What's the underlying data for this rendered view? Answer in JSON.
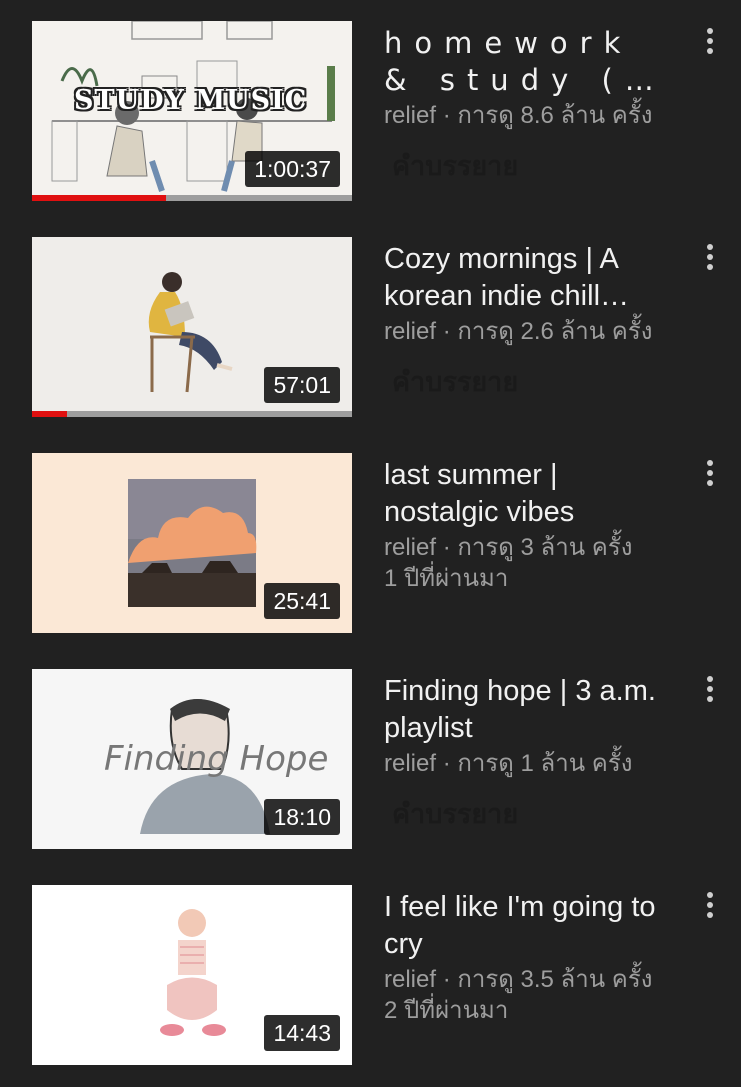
{
  "videos": [
    {
      "title_line1": "homework",
      "title_line2": "& study (…",
      "meta": "relief · การดู 8.6 ล้าน ครั้ง",
      "sub": "คำบรรยาย",
      "duration": "1:00:37",
      "progress": 0.42,
      "thumb_text": "STUDY MUSIC"
    },
    {
      "title": "Cozy mornings | A korean indie chill…",
      "meta": "relief · การดู 2.6 ล้าน ครั้ง",
      "sub": "คำบรรยาย",
      "duration": "57:01",
      "progress": 0.11
    },
    {
      "title": "last summer | nostalgic vibes",
      "meta": "relief · การดู 3 ล้าน ครั้ง",
      "sub": "1 ปีที่ผ่านมา",
      "duration": "25:41"
    },
    {
      "title": "Finding hope | 3 a.m. playlist",
      "meta": "relief · การดู 1 ล้าน ครั้ง",
      "sub": "คำบรรยาย",
      "duration": "18:10",
      "thumb_text": "Finding Hope"
    },
    {
      "title": "I feel like I'm going to cry",
      "meta": "relief · การดู 3.5 ล้าน ครั้ง",
      "sub": "2 ปีที่ผ่านมา",
      "duration": "14:43"
    }
  ],
  "icons": {
    "menu": "more-vert-icon"
  },
  "colors": {
    "background": "#212121",
    "progress": "#e01010",
    "meta_text": "#9e9e9e"
  }
}
